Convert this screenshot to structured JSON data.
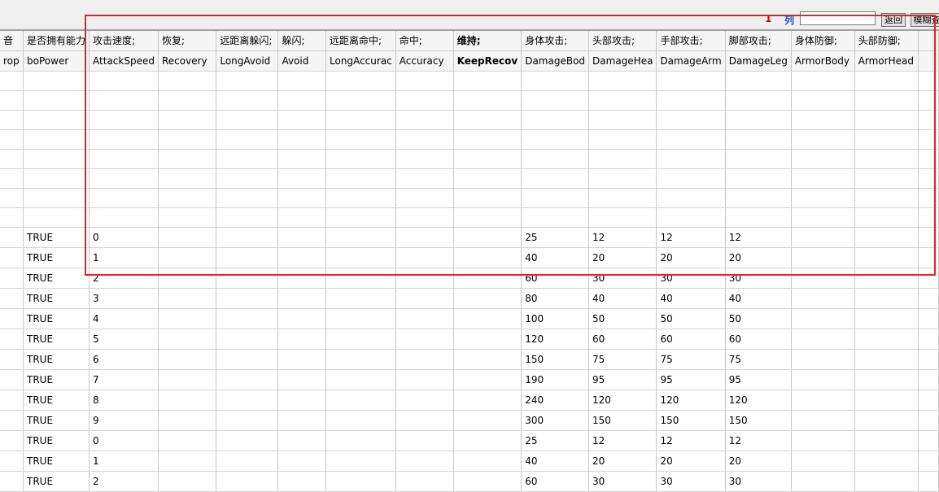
{
  "toolbar": {
    "row_number": "1",
    "col_label": "列",
    "search_value": "",
    "back_label": "返回",
    "fuzzy_label": "模糊查"
  },
  "columns": [
    {
      "cn": "音",
      "en": "rop"
    },
    {
      "cn": "是否拥有能力",
      "en": "boPower"
    },
    {
      "cn": "攻击速度;",
      "en": "AttackSpeed"
    },
    {
      "cn": "恢复;",
      "en": "Recovery"
    },
    {
      "cn": "远距离躲闪;",
      "en": "LongAvoid"
    },
    {
      "cn": "躲闪;",
      "en": "Avoid"
    },
    {
      "cn": "远距离命中;",
      "en": "LongAccurac"
    },
    {
      "cn": "命中;",
      "en": "Accuracy"
    },
    {
      "cn": "维持;",
      "en": "KeepRecov"
    },
    {
      "cn": "身体攻击;",
      "en": "DamageBod"
    },
    {
      "cn": "头部攻击;",
      "en": "DamageHea"
    },
    {
      "cn": "手部攻击;",
      "en": "DamageArm"
    },
    {
      "cn": "脚部攻击;",
      "en": "DamageLeg"
    },
    {
      "cn": "身体防御;",
      "en": "ArmorBody"
    },
    {
      "cn": "头部防御;",
      "en": "ArmorHead"
    },
    {
      "cn": "",
      "en": ""
    }
  ],
  "rows": [
    [
      "",
      "",
      "",
      "",
      "",
      "",
      "",
      "",
      "",
      "",
      "",
      "",
      "",
      "",
      "",
      ""
    ],
    [
      "",
      "",
      "",
      "",
      "",
      "",
      "",
      "",
      "",
      "",
      "",
      "",
      "",
      "",
      "",
      ""
    ],
    [
      "",
      "",
      "",
      "",
      "",
      "",
      "",
      "",
      "",
      "",
      "",
      "",
      "",
      "",
      "",
      ""
    ],
    [
      "",
      "",
      "",
      "",
      "",
      "",
      "",
      "",
      "",
      "",
      "",
      "",
      "",
      "",
      "",
      ""
    ],
    [
      "",
      "",
      "",
      "",
      "",
      "",
      "",
      "",
      "",
      "",
      "",
      "",
      "",
      "",
      "",
      ""
    ],
    [
      "",
      "",
      "",
      "",
      "",
      "",
      "",
      "",
      "",
      "",
      "",
      "",
      "",
      "",
      "",
      ""
    ],
    [
      "",
      "",
      "",
      "",
      "",
      "",
      "",
      "",
      "",
      "",
      "",
      "",
      "",
      "",
      "",
      ""
    ],
    [
      "",
      "",
      "",
      "",
      "",
      "",
      "",
      "",
      "",
      "",
      "",
      "",
      "",
      "",
      "",
      ""
    ],
    [
      "",
      "TRUE",
      "0",
      "",
      "",
      "",
      "",
      "",
      "",
      "25",
      "12",
      "12",
      "12",
      "",
      "",
      ""
    ],
    [
      "",
      "TRUE",
      "1",
      "",
      "",
      "",
      "",
      "",
      "",
      "40",
      "20",
      "20",
      "20",
      "",
      "",
      ""
    ],
    [
      "",
      "TRUE",
      "2",
      "",
      "",
      "",
      "",
      "",
      "",
      "60",
      "30",
      "30",
      "30",
      "",
      "",
      ""
    ],
    [
      "",
      "TRUE",
      "3",
      "",
      "",
      "",
      "",
      "",
      "",
      "80",
      "40",
      "40",
      "40",
      "",
      "",
      ""
    ],
    [
      "",
      "TRUE",
      "4",
      "",
      "",
      "",
      "",
      "",
      "",
      "100",
      "50",
      "50",
      "50",
      "",
      "",
      ""
    ],
    [
      "",
      "TRUE",
      "5",
      "",
      "",
      "",
      "",
      "",
      "",
      "120",
      "60",
      "60",
      "60",
      "",
      "",
      ""
    ],
    [
      "",
      "TRUE",
      "6",
      "",
      "",
      "",
      "",
      "",
      "",
      "150",
      "75",
      "75",
      "75",
      "",
      "",
      ""
    ],
    [
      "",
      "TRUE",
      "7",
      "",
      "",
      "",
      "",
      "",
      "",
      "190",
      "95",
      "95",
      "95",
      "",
      "",
      ""
    ],
    [
      "",
      "TRUE",
      "8",
      "",
      "",
      "",
      "",
      "",
      "",
      "240",
      "120",
      "120",
      "120",
      "",
      "",
      ""
    ],
    [
      "",
      "TRUE",
      "9",
      "",
      "",
      "",
      "",
      "",
      "",
      "300",
      "150",
      "150",
      "150",
      "",
      "",
      ""
    ],
    [
      "",
      "TRUE",
      "0",
      "",
      "",
      "",
      "",
      "",
      "",
      "25",
      "12",
      "12",
      "12",
      "",
      "",
      ""
    ],
    [
      "",
      "TRUE",
      "1",
      "",
      "",
      "",
      "",
      "",
      "",
      "40",
      "20",
      "20",
      "20",
      "",
      "",
      ""
    ],
    [
      "",
      "TRUE",
      "2",
      "",
      "",
      "",
      "",
      "",
      "",
      "60",
      "30",
      "30",
      "30",
      "",
      "",
      ""
    ]
  ],
  "colors": {
    "highlight_border": "#e8202a",
    "row_number_color": "#e00000",
    "col_label_color": "#1a4fd0"
  }
}
